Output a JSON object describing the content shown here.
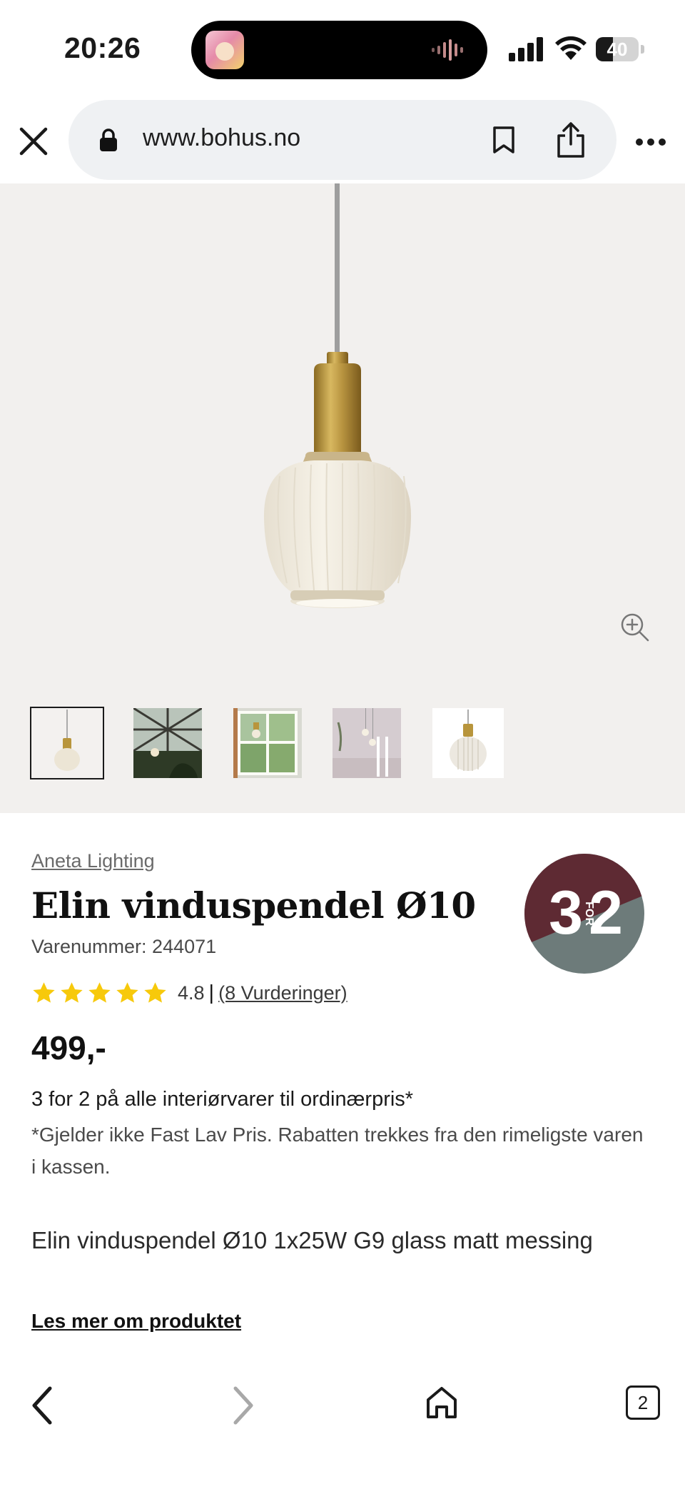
{
  "status_bar": {
    "time": "20:26",
    "battery_level": "40",
    "battery_fraction": 0.4,
    "island_app_icon": "magazine-app-icon",
    "island_activity_icon": "audio-waveform-icon"
  },
  "browser": {
    "url": "www.bohus.no",
    "close_icon": "close-icon",
    "lock_icon": "lock-icon",
    "bookmark_icon": "bookmark-icon",
    "share_icon": "share-icon",
    "more_icon": "more-icon"
  },
  "gallery": {
    "zoom_icon": "zoom-in-icon",
    "thumbnails": [
      {
        "name": "thumbnail-1",
        "active": true
      },
      {
        "name": "thumbnail-2",
        "active": false
      },
      {
        "name": "thumbnail-3",
        "active": false
      },
      {
        "name": "thumbnail-4",
        "active": false
      },
      {
        "name": "thumbnail-5",
        "active": false
      }
    ]
  },
  "product": {
    "brand": "Aneta Lighting",
    "title": "Elin vinduspendel Ø10",
    "sku": "Varenummer: 244071",
    "rating": {
      "stars": 5,
      "value": "4.8",
      "separator": "|",
      "reviews": "(8 Vurderinger)"
    },
    "price": "499,-",
    "badge": {
      "left": "3",
      "middle": "FOR",
      "right": "2"
    },
    "promo_title": "3 for 2 på alle interiørvarer til ordinærpris*",
    "promo_note": "*Gjelder ikke Fast Lav Pris. Rabatten trekkes fra den rimeligste varen i kassen.",
    "description": "Elin vinduspendel Ø10 1x25W G9 glass matt messing",
    "read_more": "Les mer om produktet"
  },
  "toolbar": {
    "back_icon": "back-icon",
    "forward_icon": "forward-icon",
    "home_icon": "home-icon",
    "tab_count": "2"
  },
  "colors": {
    "gallery_bg": "#f2f0ee",
    "url_pill_bg": "#eff1f3",
    "star": "#f7c90b",
    "badge_top": "#5e2a33",
    "badge_bottom": "#6d7b7a",
    "brass": "#b8953c",
    "glass": "#f1ece0"
  }
}
